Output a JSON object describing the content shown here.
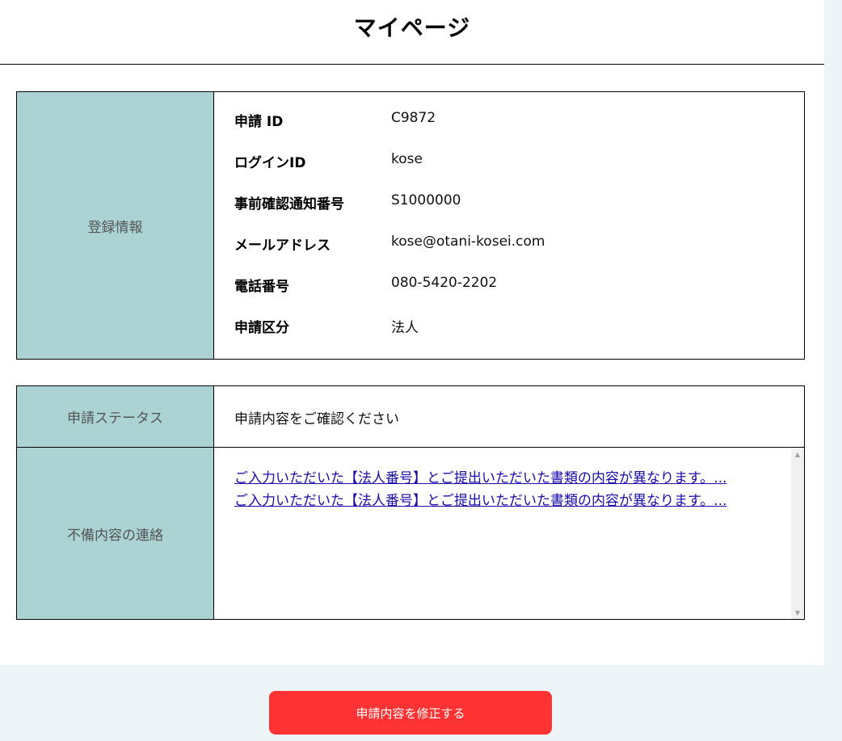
{
  "header": {
    "title": "マイページ"
  },
  "registration": {
    "label": "登録情報",
    "rows": [
      {
        "key": "申請 ID",
        "value": "C9872"
      },
      {
        "key": "ログインID",
        "value": "kose"
      },
      {
        "key": "事前確認通知番号",
        "value": "S1000000"
      },
      {
        "key": "メールアドレス",
        "value": "kose@otani-kosei.com"
      },
      {
        "key": "電話番号",
        "value": "080-5420-2202"
      },
      {
        "key": "申請区分",
        "value": "法人"
      }
    ]
  },
  "status": {
    "label": "申請ステータス",
    "value": "申請内容をご確認ください"
  },
  "defects": {
    "label": "不備内容の連絡",
    "links": [
      "ご入力いただいた【法人番号】とご提出いただいた書類の内容が異なります。...",
      "ご入力いただいた【法人番号】とご提出いただいた書類の内容が異なります。..."
    ],
    "scroll_up_icon": "triangle-up-icon",
    "scroll_down_icon": "triangle-down-icon"
  },
  "actions": {
    "edit_label": "申請内容を修正する"
  },
  "colors": {
    "label_bg": "#abd3d3",
    "button_bg": "#ff3333",
    "link": "#1a0dab",
    "outer_bg": "#eef5f8"
  }
}
